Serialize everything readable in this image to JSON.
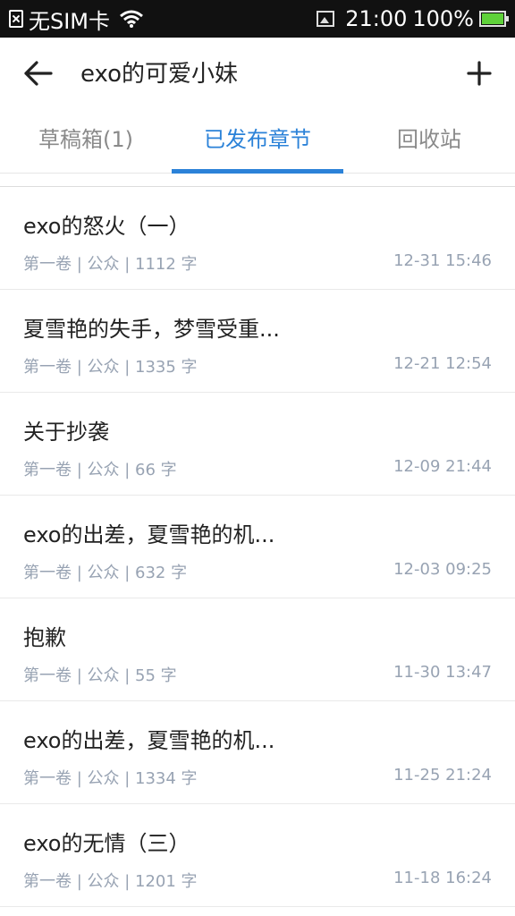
{
  "status_bar": {
    "carrier": "无SIM卡",
    "time": "21:00",
    "battery": "100%"
  },
  "header": {
    "title": "exo的可爱小妹"
  },
  "tabs": [
    {
      "label": "草稿箱(1)"
    },
    {
      "label": "已发布章节"
    },
    {
      "label": "回收站"
    }
  ],
  "chapters": [
    {
      "title": "exo的怒火（一）",
      "meta": "第一卷 | 公众 | 1112 字",
      "time": "12-31 15:46"
    },
    {
      "title": "夏雪艳的失手，梦雪受重...",
      "meta": "第一卷 | 公众 | 1335 字",
      "time": "12-21 12:54"
    },
    {
      "title": "关于抄袭",
      "meta": "第一卷 | 公众 | 66 字",
      "time": "12-09 21:44"
    },
    {
      "title": "exo的出差，夏雪艳的机...",
      "meta": "第一卷 | 公众 | 632 字",
      "time": "12-03 09:25"
    },
    {
      "title": "抱歉",
      "meta": "第一卷 | 公众 | 55 字",
      "time": "11-30 13:47"
    },
    {
      "title": "exo的出差，夏雪艳的机...",
      "meta": "第一卷 | 公众 | 1334 字",
      "time": "11-25 21:24"
    },
    {
      "title": "exo的无情（三）",
      "meta": "第一卷 | 公众 | 1201 字",
      "time": "11-18 16:24"
    }
  ],
  "colors": {
    "accent": "#2b82d8",
    "meta_text": "#98a3b3",
    "status_bar_bg": "#111111",
    "battery_green": "#5fd13a"
  },
  "icons": {
    "back": "arrow-left-icon",
    "add": "plus-icon",
    "sim": "no-sim-icon",
    "wifi": "wifi-icon",
    "screenshot": "image-icon",
    "battery": "battery-icon"
  }
}
